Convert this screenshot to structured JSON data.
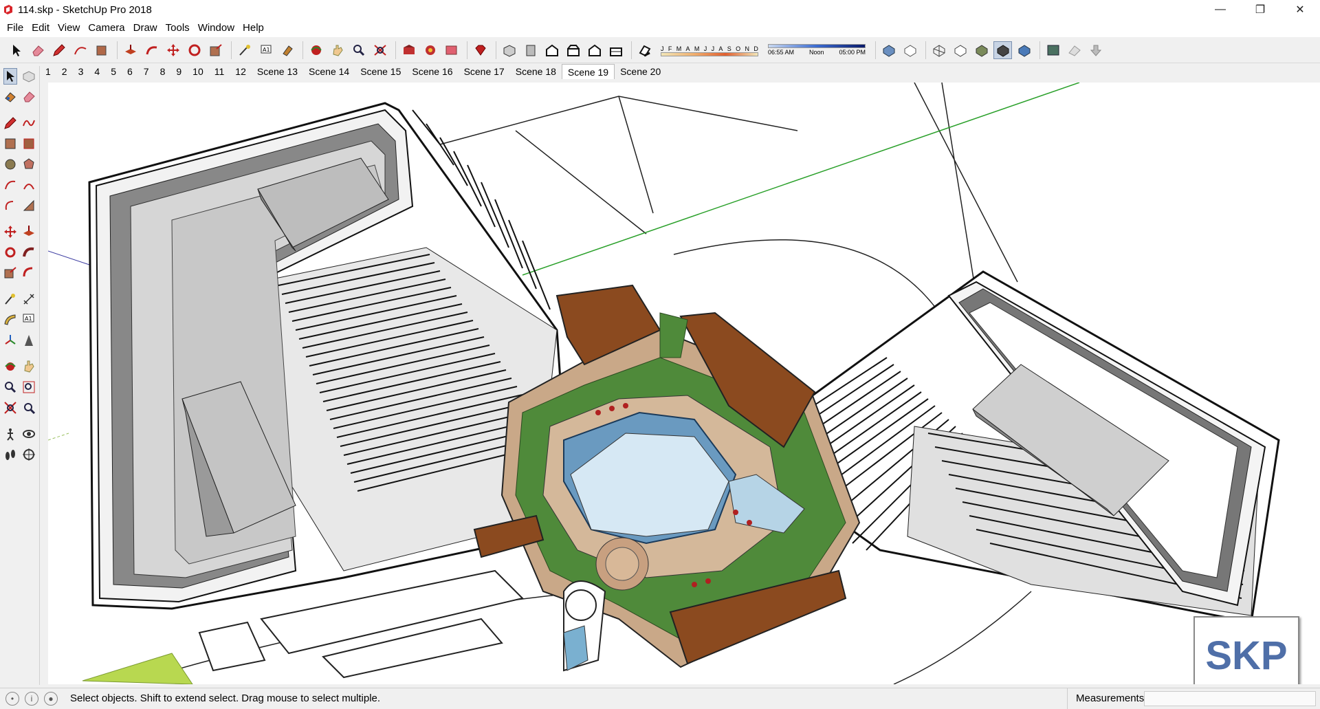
{
  "window": {
    "title": "114.skp - SketchUp Pro 2018",
    "controls": [
      "minimize",
      "restore",
      "close"
    ]
  },
  "menu": [
    "File",
    "Edit",
    "View",
    "Camera",
    "Draw",
    "Tools",
    "Window",
    "Help"
  ],
  "toolbar": {
    "icons": [
      "select-icon",
      "eraser-icon",
      "pencil-icon",
      "arc-icon",
      "paint-bucket-icon",
      "push-pull-icon",
      "follow-me-icon",
      "move-icon",
      "rotate-icon",
      "scale-icon",
      "tape-measure-icon",
      "text-icon",
      "paint-icon",
      "orbit-icon",
      "pan-icon",
      "zoom-icon",
      "zoom-extents-icon",
      "warehouse-icon",
      "extension-icon",
      "send-icon",
      "ruby-icon",
      "iso-view-icon",
      "top-view-icon",
      "front-view-icon",
      "right-view-icon",
      "back-view-icon",
      "left-view-icon",
      "shadows-icon"
    ],
    "shadow_months": [
      "J",
      "F",
      "M",
      "A",
      "M",
      "J",
      "J",
      "A",
      "S",
      "O",
      "N",
      "D"
    ],
    "time_labels": [
      "06:55 AM",
      "Noon",
      "05:00 PM"
    ],
    "style_icons": [
      "xray-icon",
      "back-edges-icon",
      "wireframe-icon",
      "hidden-line-icon",
      "shaded-icon",
      "shaded-textures-icon",
      "monochrome-icon",
      "section-plane-icon",
      "section-cut-icon",
      "section-fill-icon"
    ]
  },
  "scenes": [
    "1",
    "2",
    "3",
    "4",
    "5",
    "6",
    "7",
    "8",
    "9",
    "10",
    "11",
    "12",
    "Scene 13",
    "Scene 14",
    "Scene 15",
    "Scene 16",
    "Scene 17",
    "Scene 18",
    "Scene 19",
    "Scene 20"
  ],
  "active_scene": "Scene 19",
  "left_tools": [
    [
      "select-icon",
      "component-icon"
    ],
    [
      "paint-bucket-icon",
      "eraser-icon"
    ],
    [
      "line-icon",
      "freehand-icon"
    ],
    [
      "rectangle-icon",
      "rotated-rectangle-icon"
    ],
    [
      "circle-icon",
      "polygon-icon"
    ],
    [
      "arc-icon",
      "two-point-arc-icon"
    ],
    [
      "three-point-arc-icon",
      "pie-icon"
    ],
    [
      "move-icon",
      "push-pull-icon"
    ],
    [
      "rotate-icon",
      "follow-me-icon"
    ],
    [
      "scale-icon",
      "offset-icon"
    ],
    [
      "tape-measure-icon",
      "dimension-icon"
    ],
    [
      "protractor-icon",
      "text-icon"
    ],
    [
      "axes-icon",
      "3d-text-icon"
    ],
    [
      "orbit-icon",
      "pan-icon"
    ],
    [
      "zoom-icon",
      "zoom-window-icon"
    ],
    [
      "zoom-extents-icon",
      "previous-view-icon"
    ],
    [
      "position-camera-icon",
      "look-around-icon"
    ],
    [
      "walk-icon",
      "section-plane-icon"
    ]
  ],
  "status": {
    "hint": "Select objects. Shift to extend select. Drag mouse to select multiple.",
    "measurements_label": "Measurements",
    "measurements_value": ""
  },
  "watermark": "SKP",
  "colors": {
    "roof_brown": "#8b4a1f",
    "lawn_green": "#4f8a3a",
    "water_blue": "#a8d0e8",
    "paving_tan": "#c9a888",
    "axis_green": "#2aa02a"
  }
}
